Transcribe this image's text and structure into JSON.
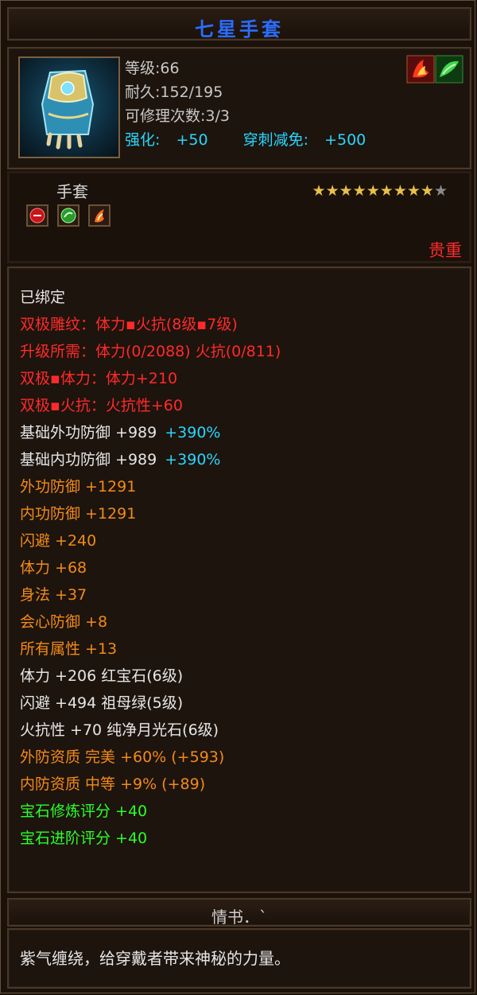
{
  "item": {
    "name": "七星手套",
    "level_line": "等级:66",
    "durability_line": "耐久:152/195",
    "repair_line": "可修理次数:3/3",
    "strengthen_label": "强化:",
    "strengthen_value": "+50",
    "pierce_label": "穿刺减免:",
    "pierce_value": "+500",
    "type": "手套",
    "stars_total": 10,
    "stars_filled": 9,
    "rarity": "贵重"
  },
  "attributes": [
    {
      "text": "已绑定",
      "color": "white"
    },
    {
      "text": "双极雕纹：体力▪火抗(8级▪7级)",
      "color": "red"
    },
    {
      "text": "升级所需：体力(0/2088)  火抗(0/811)",
      "color": "red"
    },
    {
      "text": "双极▪体力：体力+210",
      "color": "red"
    },
    {
      "text": "双极▪火抗：火抗性+60",
      "color": "red"
    },
    {
      "text": "基础外功防御 +989",
      "extra": "+390%",
      "color": "white"
    },
    {
      "text": "基础内功防御 +989",
      "extra": "+390%",
      "color": "white"
    },
    {
      "text": "外功防御 +1291",
      "color": "orange"
    },
    {
      "text": "内功防御 +1291",
      "color": "orange"
    },
    {
      "text": "闪避 +240",
      "color": "orange"
    },
    {
      "text": "体力 +68",
      "color": "orange"
    },
    {
      "text": "身法 +37",
      "color": "orange"
    },
    {
      "text": "会心防御 +8",
      "color": "orange"
    },
    {
      "text": "所有属性 +13",
      "color": "orange"
    },
    {
      "text": "体力 +206 红宝石(6级)",
      "color": "white"
    },
    {
      "text": "闪避 +494 祖母绿(5级)",
      "color": "white"
    },
    {
      "text": "火抗性 +70 纯净月光石(6级)",
      "color": "white"
    },
    {
      "text": "外防资质  完美 +60% (+593)",
      "color": "orange"
    },
    {
      "text": "内防资质  中等 +9% (+89)",
      "color": "orange"
    },
    {
      "text": "宝石修炼评分 +40",
      "color": "green"
    },
    {
      "text": "宝石进阶评分 +40",
      "color": "green"
    }
  ],
  "book": {
    "title": "情书．`",
    "description": "紫气缠绕，给穿戴者带来神秘的力量。"
  }
}
